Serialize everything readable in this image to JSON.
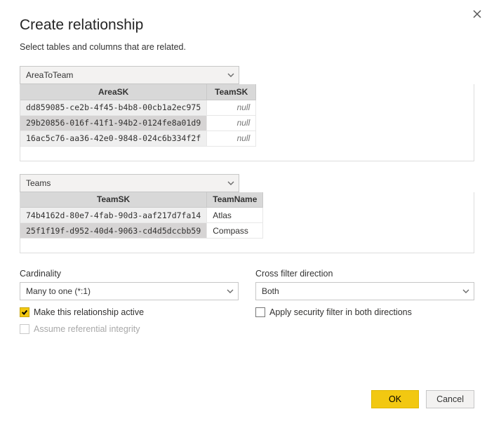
{
  "title": "Create relationship",
  "subtitle": "Select tables and columns that are related.",
  "table1": {
    "select": "AreaToTeam",
    "columns": [
      "AreaSK",
      "TeamSK"
    ],
    "rows": [
      {
        "AreaSK": "dd859085-ce2b-4f45-b4b8-00cb1a2ec975",
        "TeamSK": "null"
      },
      {
        "AreaSK": "29b20856-016f-41f1-94b2-0124fe8a01d9",
        "TeamSK": "null"
      },
      {
        "AreaSK": "16ac5c76-aa36-42e0-9848-024c6b334f2f",
        "TeamSK": "null"
      }
    ]
  },
  "table2": {
    "select": "Teams",
    "columns": [
      "TeamSK",
      "TeamName"
    ],
    "rows": [
      {
        "TeamSK": "74b4162d-80e7-4fab-90d3-aaf217d7fa14",
        "TeamName": "Atlas"
      },
      {
        "TeamSK": "25f1f19f-d952-40d4-9063-cd4d5dccbb59",
        "TeamName": "Compass"
      }
    ]
  },
  "cardinality": {
    "label": "Cardinality",
    "value": "Many to one (*:1)"
  },
  "crossfilter": {
    "label": "Cross filter direction",
    "value": "Both"
  },
  "checks": {
    "active": "Make this relationship active",
    "referential": "Assume referential integrity",
    "security": "Apply security filter in both directions"
  },
  "buttons": {
    "ok": "OK",
    "cancel": "Cancel"
  }
}
